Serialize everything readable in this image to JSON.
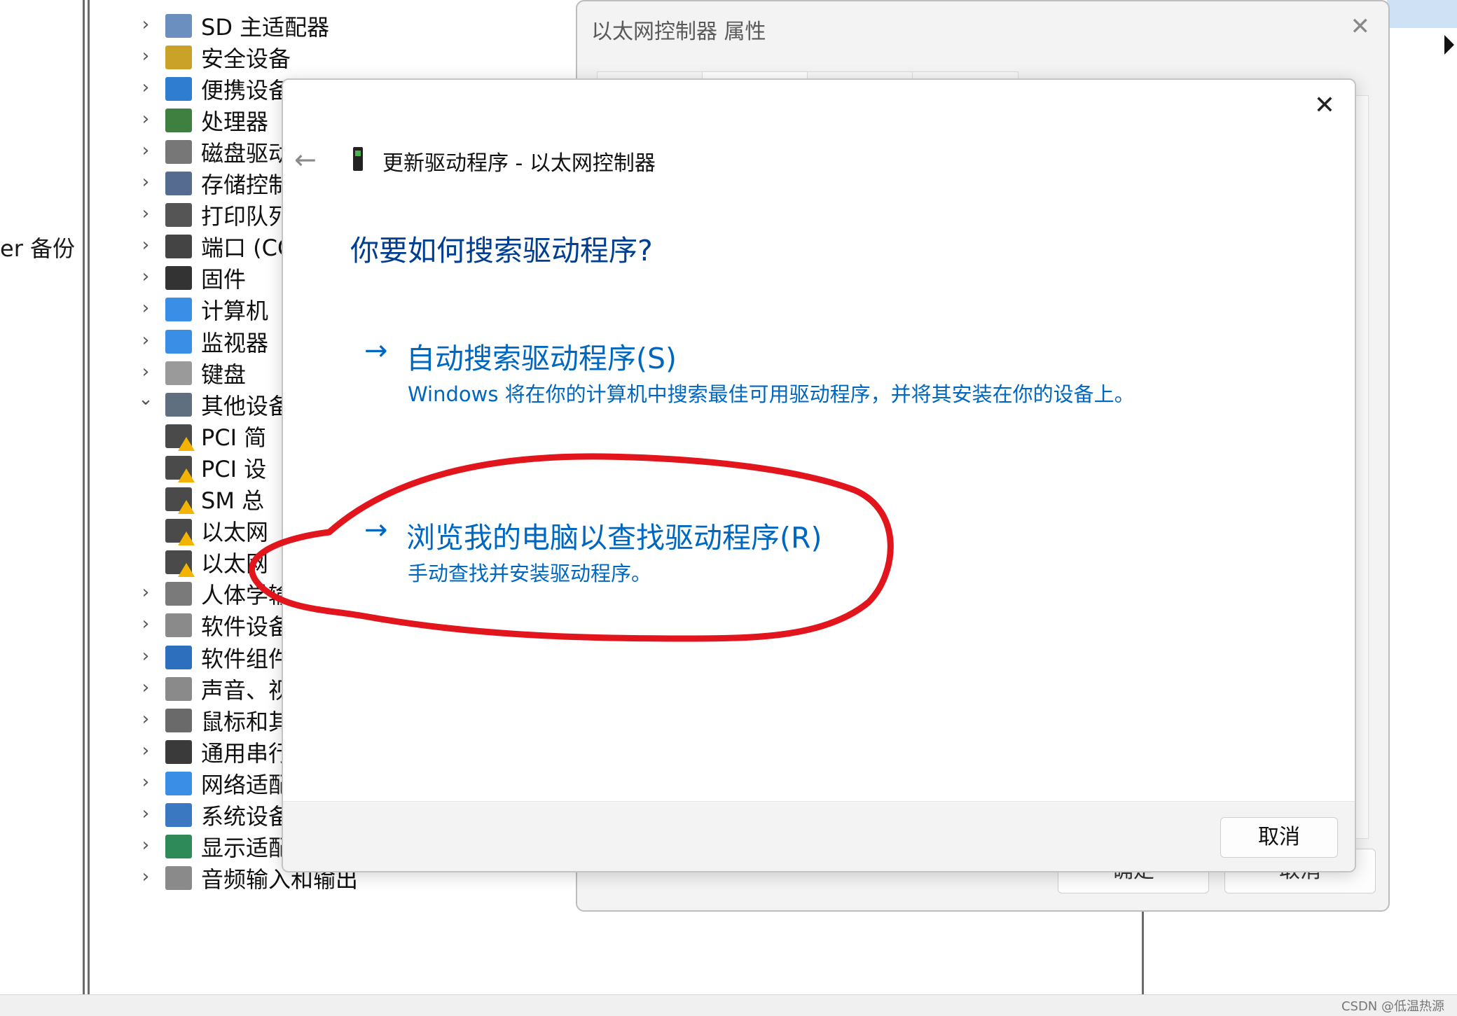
{
  "left_pane": {
    "text": "er 备份"
  },
  "device_tree": {
    "items": [
      {
        "label": "SD 主适配器",
        "expanded": false,
        "icon": "sd-card-icon"
      },
      {
        "label": "安全设备",
        "expanded": false,
        "icon": "security-key-icon"
      },
      {
        "label": "便携设备",
        "expanded": false,
        "icon": "portable-device-icon"
      },
      {
        "label": "处理器",
        "expanded": false,
        "icon": "processor-icon"
      },
      {
        "label": "磁盘驱动",
        "expanded": false,
        "icon": "disk-drive-icon"
      },
      {
        "label": "存储控制",
        "expanded": false,
        "icon": "storage-controller-icon"
      },
      {
        "label": "打印队列",
        "expanded": false,
        "icon": "printer-icon"
      },
      {
        "label": "端口 (CO",
        "expanded": false,
        "icon": "port-icon"
      },
      {
        "label": "固件",
        "expanded": false,
        "icon": "firmware-icon"
      },
      {
        "label": "计算机",
        "expanded": false,
        "icon": "computer-icon"
      },
      {
        "label": "监视器",
        "expanded": false,
        "icon": "monitor-icon"
      },
      {
        "label": "键盘",
        "expanded": false,
        "icon": "keyboard-icon"
      },
      {
        "label": "其他设备",
        "expanded": true,
        "icon": "unknown-device-icon"
      },
      {
        "label": "PCI 简",
        "child": true,
        "icon": "warning-device-icon"
      },
      {
        "label": "PCI 设",
        "child": true,
        "icon": "warning-device-icon"
      },
      {
        "label": "SM 总",
        "child": true,
        "icon": "warning-device-icon"
      },
      {
        "label": "以太网",
        "child": true,
        "icon": "warning-device-icon"
      },
      {
        "label": "以太网",
        "child": true,
        "icon": "warning-device-icon"
      },
      {
        "label": "人体学输",
        "expanded": false,
        "icon": "hid-icon"
      },
      {
        "label": "软件设备",
        "expanded": false,
        "icon": "software-device-icon"
      },
      {
        "label": "软件组件",
        "expanded": false,
        "icon": "software-component-icon"
      },
      {
        "label": "声音、视",
        "expanded": false,
        "icon": "speaker-icon"
      },
      {
        "label": "鼠标和其",
        "expanded": false,
        "icon": "mouse-icon"
      },
      {
        "label": "通用串行",
        "expanded": false,
        "icon": "usb-icon"
      },
      {
        "label": "网络适配",
        "expanded": false,
        "icon": "network-adapter-icon"
      },
      {
        "label": "系统设备",
        "expanded": false,
        "icon": "system-device-icon"
      },
      {
        "label": "显示适配",
        "expanded": false,
        "icon": "display-adapter-icon"
      },
      {
        "label": "音频输入和输出",
        "expanded": false,
        "icon": "audio-io-icon"
      }
    ]
  },
  "properties_window": {
    "title": "以太网控制器 属性",
    "ok_label": "确定",
    "cancel_label": "取消"
  },
  "update_dialog": {
    "title": "更新驱动程序 - 以太网控制器",
    "question": "你要如何搜索驱动程序?",
    "option_auto": {
      "title": "自动搜索驱动程序(S)",
      "desc": "Windows 将在你的计算机中搜索最佳可用驱动程序，并将其安装在你的设备上。"
    },
    "option_browse": {
      "title": "浏览我的电脑以查找驱动程序(R)",
      "desc": "手动查找并安装驱动程序。"
    },
    "cancel_label": "取消"
  },
  "watermark": "CSDN @低温热源",
  "colors": {
    "link": "#0067c0",
    "heading": "#003e92",
    "annotation": "#e2141c"
  }
}
